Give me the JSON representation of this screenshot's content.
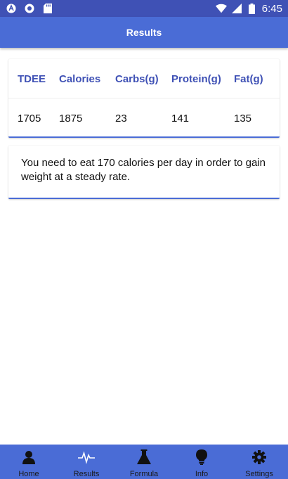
{
  "status_bar": {
    "time": "6:45",
    "left_icons": [
      "app-logo-icon",
      "circle-icon",
      "sd-card-icon"
    ],
    "right_icons": [
      "wifi-icon",
      "signal-icon",
      "battery-icon"
    ]
  },
  "app_bar": {
    "title": "Results"
  },
  "results_table": {
    "headers": [
      "TDEE",
      "Calories",
      "Carbs(g)",
      "Protein(g)",
      "Fat(g)"
    ],
    "values": [
      "1705",
      "1875",
      "23",
      "141",
      "135"
    ]
  },
  "message": {
    "text": "You need to eat 170 calories per day in order to gain weight at a steady rate."
  },
  "bottom_nav": {
    "items": [
      {
        "label": "Home",
        "icon": "person-icon"
      },
      {
        "label": "Results",
        "icon": "pulse-icon"
      },
      {
        "label": "Formula",
        "icon": "flask-icon"
      },
      {
        "label": "Info",
        "icon": "lightbulb-icon"
      },
      {
        "label": "Settings",
        "icon": "gear-icon"
      }
    ]
  },
  "colors": {
    "primary": "#4A6CD6",
    "status_bar": "#3F51B5",
    "header_text": "#3F51B5"
  }
}
